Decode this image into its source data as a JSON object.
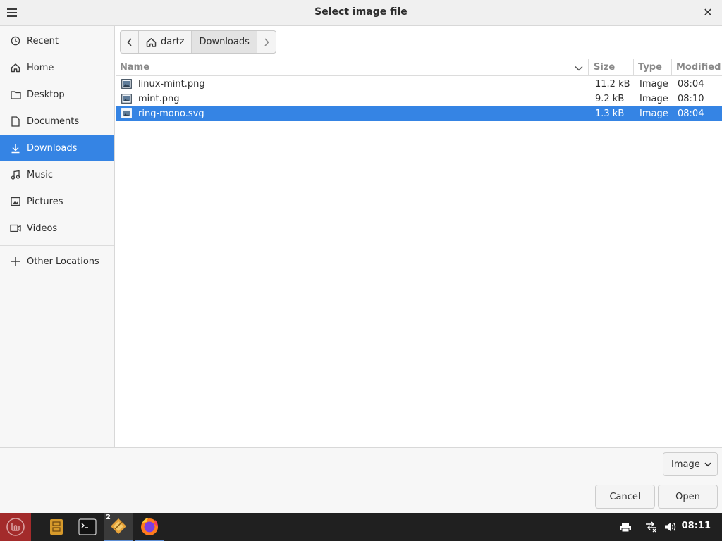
{
  "window": {
    "title": "Select image file"
  },
  "sidebar": {
    "items": [
      {
        "label": "Recent",
        "icon": "clock-icon"
      },
      {
        "label": "Home",
        "icon": "home-icon"
      },
      {
        "label": "Desktop",
        "icon": "folder-icon"
      },
      {
        "label": "Documents",
        "icon": "document-icon"
      },
      {
        "label": "Downloads",
        "icon": "download-icon"
      },
      {
        "label": "Music",
        "icon": "music-icon"
      },
      {
        "label": "Pictures",
        "icon": "picture-icon"
      },
      {
        "label": "Videos",
        "icon": "video-icon"
      }
    ],
    "other": {
      "label": "Other Locations",
      "icon": "plus-icon"
    },
    "active_index": 4
  },
  "pathbar": {
    "home": "dartz",
    "current": "Downloads"
  },
  "columns": {
    "name": "Name",
    "size": "Size",
    "type": "Type",
    "modified": "Modified"
  },
  "files": [
    {
      "name": "linux-mint.png",
      "size": "11.2 kB",
      "type": "Image",
      "modified": "08:04"
    },
    {
      "name": "mint.png",
      "size": "9.2 kB",
      "type": "Image",
      "modified": "08:10"
    },
    {
      "name": "ring-mono.svg",
      "size": "1.3 kB",
      "type": "Image",
      "modified": "08:04"
    }
  ],
  "selected_file_index": 2,
  "filter": {
    "selected": "Image"
  },
  "buttons": {
    "cancel": "Cancel",
    "open": "Open"
  },
  "taskbar": {
    "clock": "08:11",
    "badge_count": "2",
    "colors": {
      "menu": "#a32b2b",
      "accent": "#3584e4"
    }
  }
}
